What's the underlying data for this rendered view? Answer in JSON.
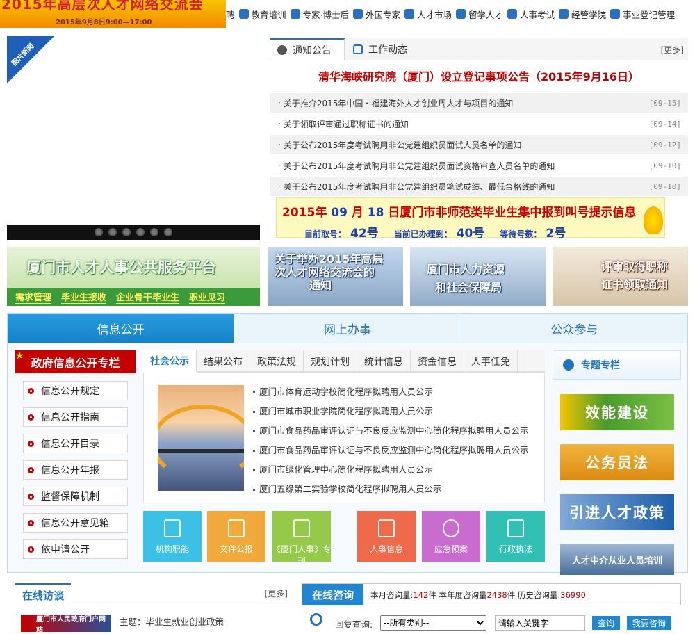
{
  "top_banner": {
    "title": "2015年高层次人才网络交流会",
    "date": "2015年9月8日9:00—17:00"
  },
  "top_nav": [
    {
      "label": "聘",
      "icon": "recruit-icon"
    },
    {
      "label": "教育培训",
      "icon": "education-icon"
    },
    {
      "label": "专家·博士后",
      "icon": "expert-icon"
    },
    {
      "label": "外国专家",
      "icon": "globe-icon"
    },
    {
      "label": "人才市场",
      "icon": "people-icon"
    },
    {
      "label": "留学人才",
      "icon": "student-icon"
    },
    {
      "label": "人事考试",
      "icon": "exam-icon"
    },
    {
      "label": "经管学院",
      "icon": "academy-icon"
    },
    {
      "label": "事业登记管理",
      "icon": "registration-icon"
    }
  ],
  "slideshow": {
    "corner_label": "图片新闻",
    "dot_count": 6
  },
  "notice": {
    "tabs": [
      {
        "label": "通知公告"
      },
      {
        "label": "工作动态"
      }
    ],
    "more": "[更多]",
    "headline": "清华海峡研究院（厦门）设立登记事项公告（2015年9月16日）",
    "items": [
      {
        "title": "关于推介2015年中国・福建海外人才创业周人才与项目的通知",
        "date": "[09-15]"
      },
      {
        "title": "关于领取评审通过职称证书的通知",
        "date": "[09-14]"
      },
      {
        "title": "关于公布2015年度考试聘用非公党建组织员面试人员名单的通知",
        "date": "[09-12]"
      },
      {
        "title": "关于公布2015年度考试聘用非公党建组织员面试资格审查人员名单的通知",
        "date": "[09-10]"
      },
      {
        "title": "关于公布2015年度考试聘用非公党建组织员笔试成绩、最低合格线的通知",
        "date": "[09-10]"
      }
    ],
    "queue": {
      "year": "2015年",
      "month": "09",
      "month_unit": "月",
      "day": "18",
      "rest": "日厦门市非师范类毕业生集中报到叫号提示信息",
      "current_label": "目前取号：",
      "current_value": "42号",
      "processed_label": "当前已办理到：",
      "processed_value": "40号",
      "waiting_label": "等待号数：",
      "waiting_value": "2号"
    }
  },
  "banners": {
    "platform": {
      "title": "厦门市人才人事公共服务平台",
      "links": [
        "需求管理",
        "毕业生接收",
        "企业骨干毕业生",
        "职业见习"
      ]
    },
    "b2": {
      "line1": "关于举办2015年高层",
      "line2": "次人才网络交流会的",
      "line3": "通知"
    },
    "b3": {
      "line1": "厦门市人力资源",
      "line2": "和社会保障局"
    },
    "b4": {
      "line1": "评审取得职称",
      "line2": "证书领取通知"
    }
  },
  "main_tabs": [
    {
      "label": "信息公开"
    },
    {
      "label": "网上办事"
    },
    {
      "label": "公众参与"
    }
  ],
  "gov": {
    "title": "政府信息公开专栏",
    "items": [
      "信息公开规定",
      "信息公开指南",
      "信息公开目录",
      "信息公开年报",
      "监督保障机制",
      "信息公开意见箱",
      "依申请公开"
    ]
  },
  "content_tabs": [
    "社会公示",
    "结果公布",
    "政策法规",
    "规划计划",
    "统计信息",
    "资金信息",
    "人事任免"
  ],
  "content_items": [
    "厦门市体育运动学校简化程序拟聘用人员公示",
    "厦门市城市职业学院简化程序拟聘用人员公示",
    "厦门市食品药品审评认证与不良反应监测中心简化程序拟聘用人员公示",
    "厦门市食品药品审评认证与不良反应监测中心简化程序拟聘用人员公示",
    "厦门市绿化管理中心简化程序拟聘用人员公示",
    "厦门五缘第二实验学校简化程序拟聘用人员公示"
  ],
  "tiles": [
    {
      "label": "机构职能",
      "color": "#3cc0e6",
      "icon": "building-icon"
    },
    {
      "label": "文件公报",
      "color": "#f0a93a",
      "icon": "briefcase-icon"
    },
    {
      "label": "《厦门人事》专刊",
      "color": "#95c94a",
      "icon": "document-icon"
    },
    {
      "label": "人事信息",
      "color": "#ee6a4a",
      "icon": "id-card-icon"
    },
    {
      "label": "应急预案",
      "color": "#c96cd0",
      "icon": "emergency-icon"
    },
    {
      "label": "行政执法",
      "color": "#32c0b6",
      "icon": "clipboard-icon"
    }
  ],
  "special": {
    "title": "专题专栏",
    "items": [
      "效能建设",
      "公务员法",
      "引进人才政策",
      "人才中介从业人员培训"
    ]
  },
  "visit": {
    "title": "在线访谈",
    "more": "[更多]",
    "logo_text": "厦门市人民政府门户网站",
    "topic": "主题：毕业生就业创业政策"
  },
  "consult": {
    "title": "在线咨询",
    "month_label": "本月咨询量:",
    "month_value": "142",
    "month_unit": "件",
    "year_label": "本年度咨询量",
    "year_value": "2438",
    "year_unit": "件",
    "history_label": "历史咨询量:",
    "history_value": "36990",
    "reply_label": "回复查询:",
    "select_value": "--所有类别--",
    "keyword_value": "请输入关键字",
    "query_button": "查询",
    "ask_button": "我要咨询"
  }
}
